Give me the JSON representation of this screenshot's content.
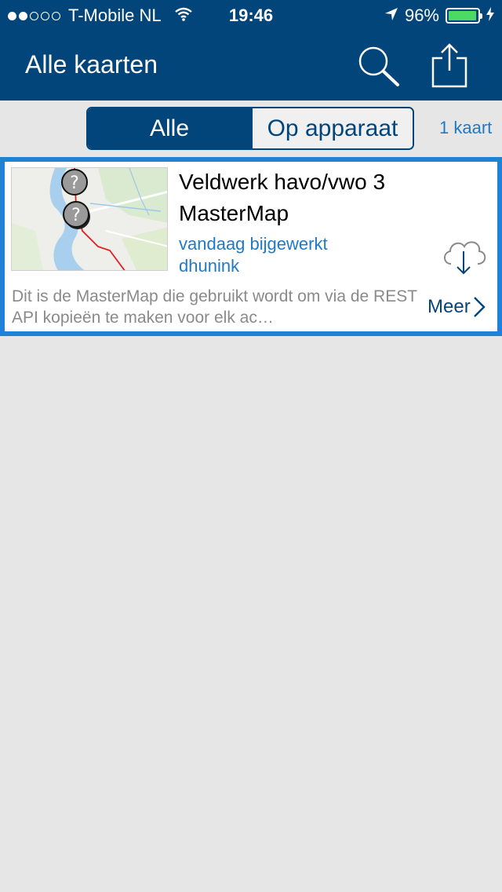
{
  "status_bar": {
    "carrier": "T-Mobile NL",
    "time": "19:46",
    "battery": "96%",
    "battery_level": 0.96,
    "signal_bars_filled": 2,
    "signal_bars_total": 5
  },
  "header": {
    "title": "Alle kaarten",
    "search_icon": "search-icon",
    "share_icon": "share-icon"
  },
  "filter": {
    "tabs": [
      {
        "label": "Alle",
        "selected": true
      },
      {
        "label": "Op apparaat",
        "selected": false
      }
    ],
    "count": "1 kaart"
  },
  "maps": [
    {
      "title": "Veldwerk havo/vwo 3 MasterMap",
      "updated": "vandaag bijgewerkt",
      "owner": "dhunink",
      "description": "Dit is de MasterMap die gebruikt wordt om via de REST API kopieën te maken voor elk ac…",
      "more_label": "Meer",
      "download_icon": "cloud-download-icon"
    }
  ],
  "colors": {
    "header_bg": "#02457a",
    "accent": "#1f7ac6",
    "card_border": "#1f82d6",
    "page_bg": "#e6e6e6",
    "battery": "#4cd964"
  }
}
